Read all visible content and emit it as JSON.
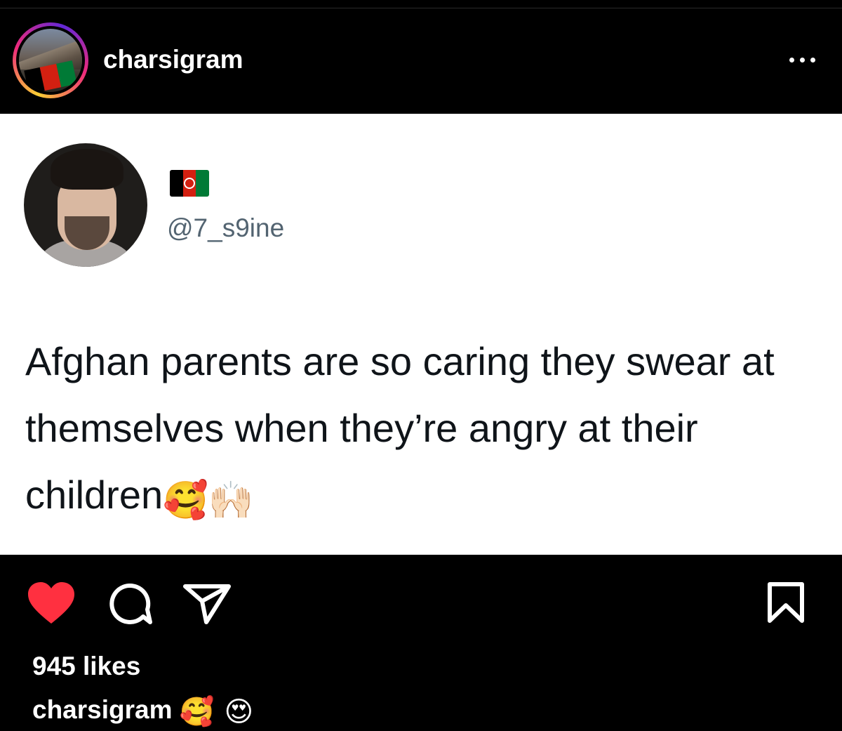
{
  "post": {
    "username": "charsigram",
    "more_label": "•••"
  },
  "tweet": {
    "handle": "@7_s9ine",
    "text": "Afghan parents are so caring they swear at themselves when they’re angry at their children",
    "emojis": [
      "🥰",
      "🙌🏻"
    ],
    "flag_colors": [
      "#000000",
      "#d32011",
      "#007a36"
    ]
  },
  "actions": {
    "liked": true,
    "like_color": "#ff3040",
    "icons": [
      "heart-icon",
      "comment-icon",
      "share-icon",
      "bookmark-icon"
    ]
  },
  "stats": {
    "likes": "945 likes"
  },
  "caption": {
    "username": "charsigram",
    "emojis": "🥰 😍"
  }
}
